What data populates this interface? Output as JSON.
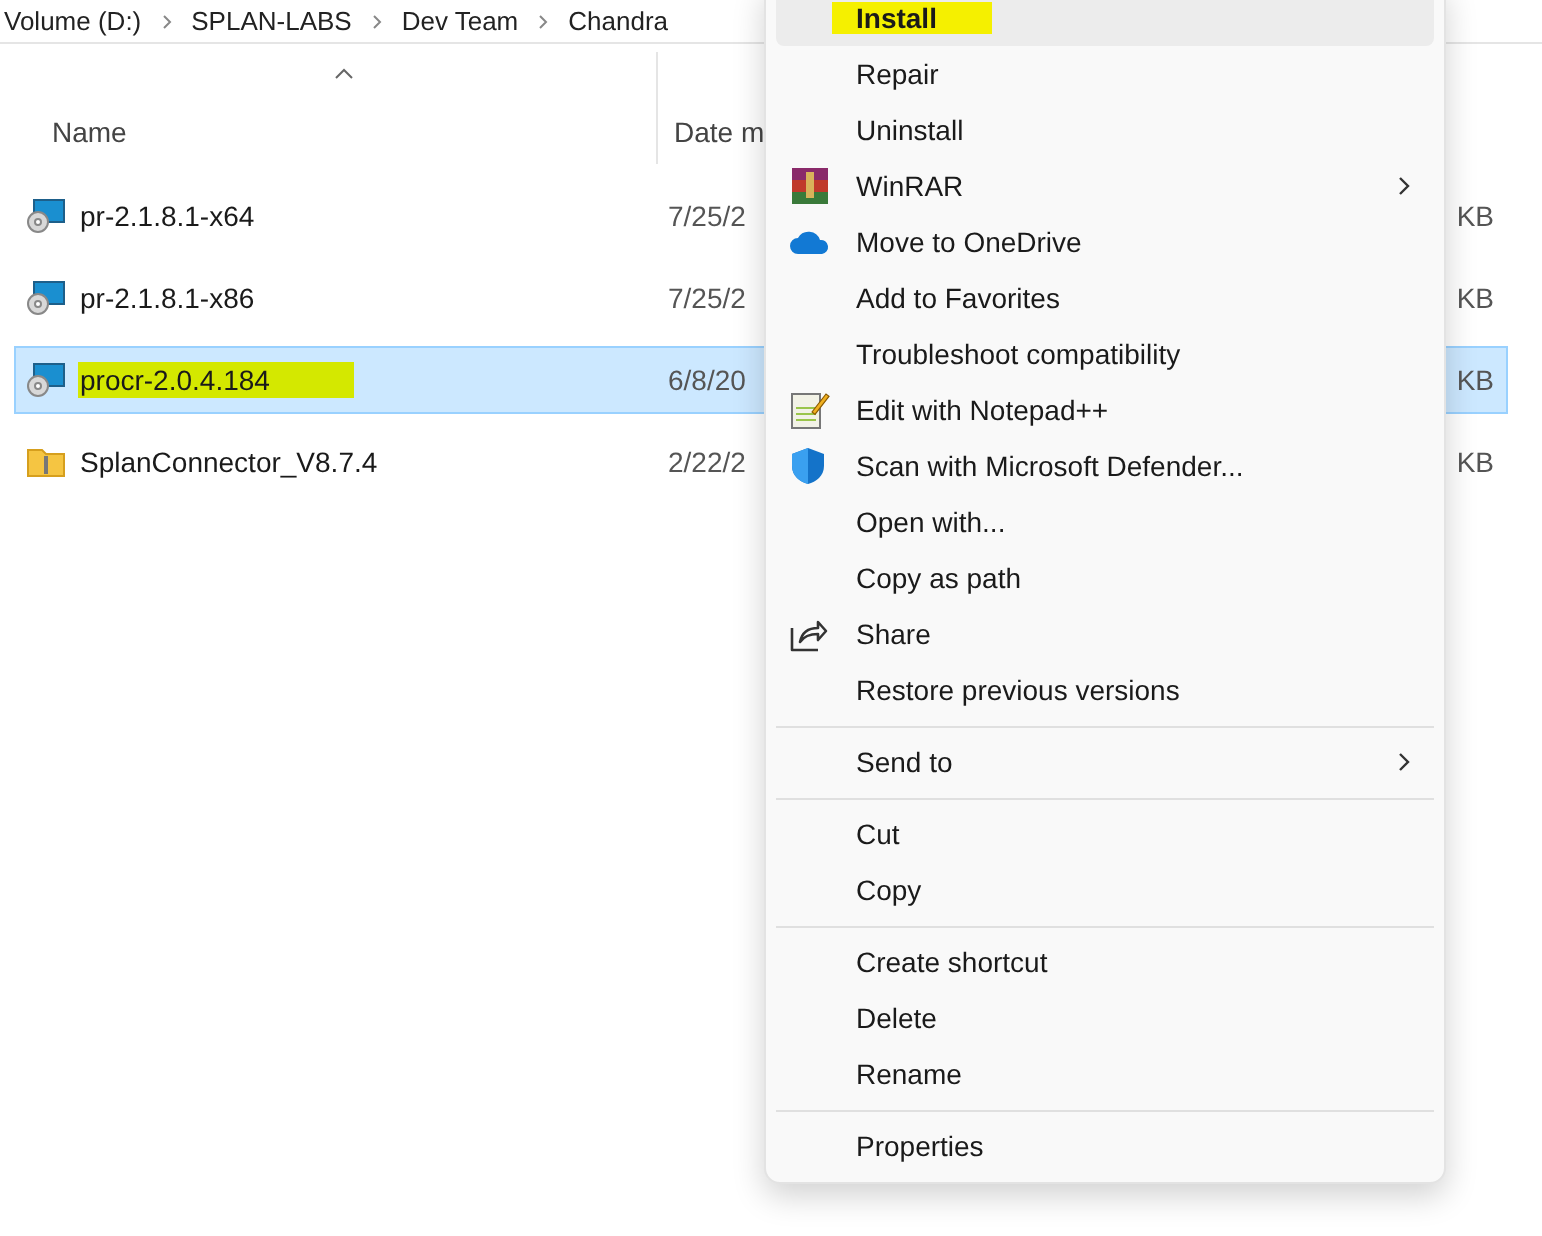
{
  "breadcrumb": [
    "Volume (D:)",
    "SPLAN-LABS",
    "Dev Team",
    "Chandra"
  ],
  "columns": [
    {
      "label": "Name",
      "sorted": true
    },
    {
      "label": "Date m",
      "sorted": false
    }
  ],
  "files": [
    {
      "name": "pr-2.1.8.1-x64",
      "date": "7/25/2",
      "size": "KB",
      "kind": "installer",
      "selected": false,
      "highlighted": false
    },
    {
      "name": "pr-2.1.8.1-x86",
      "date": "7/25/2",
      "size": "KB",
      "kind": "installer",
      "selected": false,
      "highlighted": false
    },
    {
      "name": "procr-2.0.4.184",
      "date": "6/8/20",
      "size": "KB",
      "kind": "installer",
      "selected": true,
      "highlighted": true
    },
    {
      "name": "SplanConnector_V8.7.4",
      "date": "2/22/2",
      "size": "KB",
      "kind": "archive",
      "selected": false,
      "highlighted": false
    }
  ],
  "context_menu": [
    [
      {
        "label": "Install",
        "hovered": true,
        "highlighted": true,
        "bold": true
      },
      {
        "label": "Repair",
        "hovered": false,
        "highlighted": false,
        "bold": false
      },
      {
        "label": "Uninstall",
        "hovered": false,
        "highlighted": false,
        "bold": false
      },
      {
        "label": "WinRAR",
        "kind": "archive",
        "submenu": true,
        "hovered": false,
        "highlighted": false,
        "bold": false
      },
      {
        "label": "Move to OneDrive",
        "kind": "cloud",
        "hovered": false,
        "highlighted": false,
        "bold": false
      },
      {
        "label": "Add to Favorites",
        "hovered": false,
        "highlighted": false,
        "bold": false
      },
      {
        "label": "Troubleshoot compatibility",
        "hovered": false,
        "highlighted": false,
        "bold": false
      },
      {
        "label": "Edit with Notepad++",
        "kind": "notepad",
        "hovered": false,
        "highlighted": false,
        "bold": false
      },
      {
        "label": "Scan with Microsoft Defender...",
        "kind": "shield",
        "hovered": false,
        "highlighted": false,
        "bold": false
      },
      {
        "label": "Open with...",
        "hovered": false,
        "highlighted": false,
        "bold": false
      },
      {
        "label": "Copy as path",
        "hovered": false,
        "highlighted": false,
        "bold": false
      },
      {
        "label": "Share",
        "kind": "share",
        "hovered": false,
        "highlighted": false,
        "bold": false
      },
      {
        "label": "Restore previous versions",
        "hovered": false,
        "highlighted": false,
        "bold": false
      }
    ],
    [
      {
        "label": "Send to",
        "submenu": true,
        "hovered": false,
        "highlighted": false,
        "bold": false
      }
    ],
    [
      {
        "label": "Cut",
        "hovered": false,
        "highlighted": false,
        "bold": false
      },
      {
        "label": "Copy",
        "hovered": false,
        "highlighted": false,
        "bold": false
      }
    ],
    [
      {
        "label": "Create shortcut",
        "hovered": false,
        "highlighted": false,
        "bold": false
      },
      {
        "label": "Delete",
        "hovered": false,
        "highlighted": false,
        "bold": false
      },
      {
        "label": "Rename",
        "hovered": false,
        "highlighted": false,
        "bold": false
      }
    ],
    [
      {
        "label": "Properties",
        "hovered": false,
        "highlighted": false,
        "bold": false
      }
    ]
  ]
}
